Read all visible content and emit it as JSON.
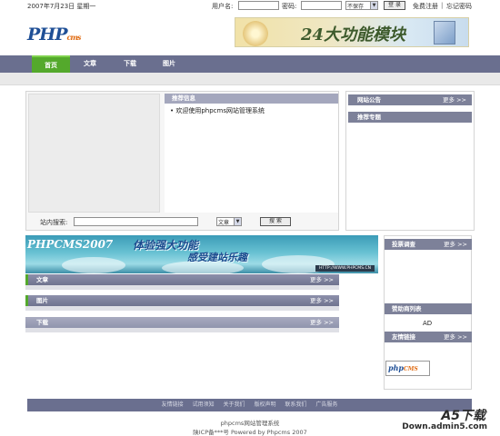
{
  "topbar": {
    "date": "2007年7月23日  星期一",
    "username_label": "用户名:",
    "password_label": "密码:",
    "save_select": "不保存",
    "login_btn": "登 录",
    "register": "免费注册",
    "separator": "|",
    "forgot": "忘记密码"
  },
  "header": {
    "logo_main": "PHP",
    "logo_sub": "cms",
    "banner_text": "24大功能模块"
  },
  "nav": {
    "items": [
      "首页",
      "文章",
      "下载",
      "图片"
    ]
  },
  "main": {
    "recommend_title": "推荐信息",
    "recommend_item": "• 欢迎使用phpcms网站管理系统",
    "search_label": "站内搜索:",
    "search_type": "文章",
    "search_btn": "搜 索"
  },
  "right": {
    "announce_title": "网站公告",
    "announce_more": "更多 >>",
    "special_title": "推荐专题"
  },
  "banner2": {
    "brand": "PHPCMS2007",
    "slogan1": "体验强大功能",
    "slogan2": "感受建站乐趣",
    "url": "HTTP://WWW.PHPCMS.CN"
  },
  "categories": [
    {
      "label": "文章",
      "more": "更多 >>"
    },
    {
      "label": "图片",
      "more": "更多 >>"
    },
    {
      "label": "下载",
      "more": "更多 >>"
    }
  ],
  "right2": {
    "vote_title": "投票调查",
    "vote_more": "更多 >>",
    "sponsor_title": "赞助商列表",
    "ad": "AD",
    "links_title": "友情链接",
    "links_more": "更多 >>",
    "partner_main": "php",
    "partner_sub": "CMS"
  },
  "footer": {
    "links": [
      "友情链接",
      "试用须知",
      "关于我们",
      "版权声明",
      "联系我们",
      "广告服务"
    ],
    "title": "phpcms网站管理系统",
    "copyright": "陕ICP备***号    Powered by Phpcms 2007"
  },
  "watermark": {
    "line1": "A5下载",
    "line2": "Down.admin5.com"
  },
  "colors": {
    "nav_bg": "#6a6f8f",
    "nav_active": "#54a92c",
    "section_head": "#7d8199"
  }
}
